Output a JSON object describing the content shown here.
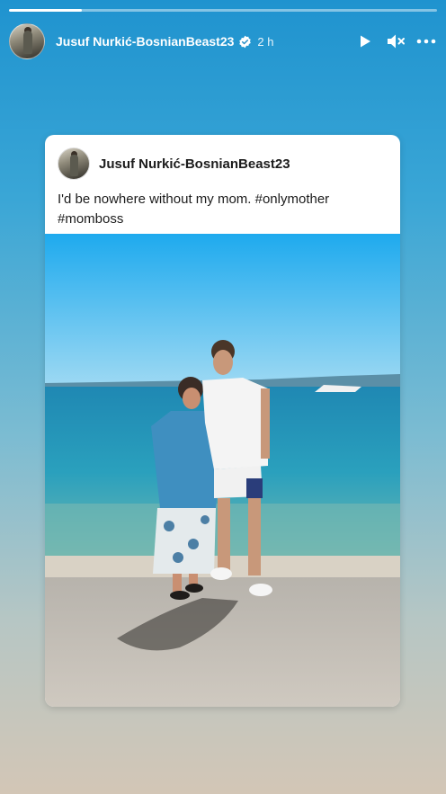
{
  "story": {
    "progress": 0.17,
    "author_name": "Jusuf Nurkić-BosnianBeast23",
    "timestamp": "2 h",
    "avatar_icon": "profile-avatar",
    "controls": {
      "play_icon": "play-icon",
      "mute_icon": "muted-speaker-icon",
      "more_icon": "more-options-icon"
    }
  },
  "post": {
    "author_name": "Jusuf Nurkić-BosnianBeast23",
    "caption": "I'd be nowhere without my mom. #onlymother #momboss",
    "photo_icon": "beach-photo"
  }
}
